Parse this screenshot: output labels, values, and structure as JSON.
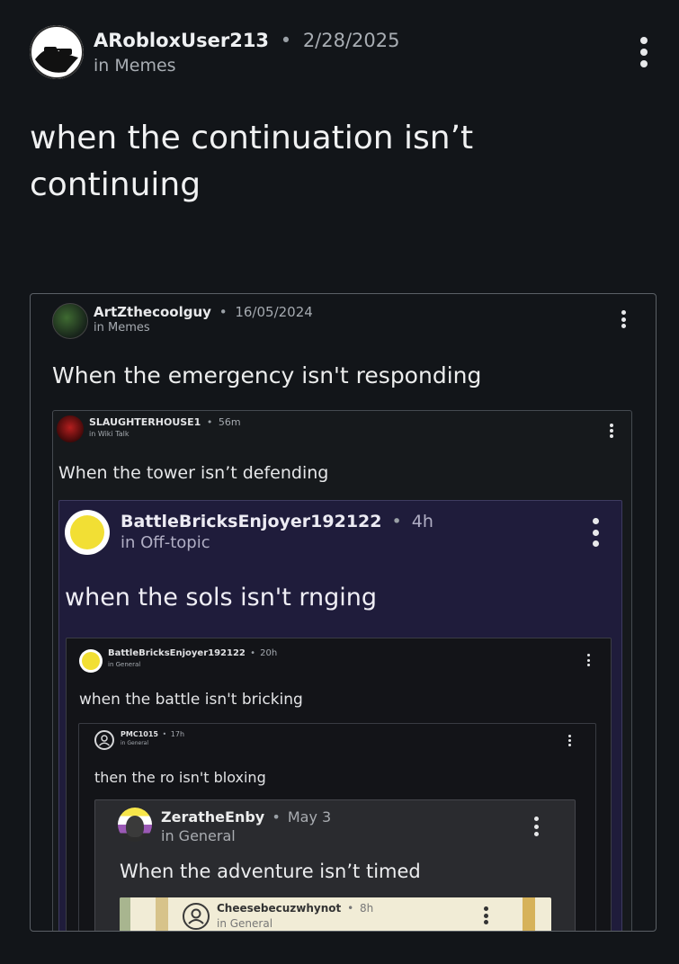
{
  "post": {
    "username": "ARobloxUser213",
    "date": "2/28/2025",
    "category": "in Memes",
    "title": "when the continuation isn’t continuing"
  },
  "embeds": [
    {
      "username": "ArtZthecoolguy",
      "time": "16/05/2024",
      "category": "in Memes",
      "text": "When the emergency isn't responding"
    },
    {
      "username": "SLAUGHTERHOUSE1",
      "time": "56m",
      "category": "in Wiki Talk",
      "text": "When the tower isn’t defending"
    },
    {
      "username": "BattleBricksEnjoyer192122",
      "time": "4h",
      "category": "in Off-topic",
      "text": "when the sols isn't rnging"
    },
    {
      "username": "BattleBricksEnjoyer192122",
      "time": "20h",
      "category": "in General",
      "text": "when the battle isn't bricking"
    },
    {
      "username": "PMC1015",
      "time": "17h",
      "category": "in General",
      "text": "then the ro isn't bloxing"
    },
    {
      "username": "ZeratheEnby",
      "time": "May 3",
      "category": "in General",
      "text": "When the adventure isn’t timed"
    },
    {
      "username": "Cheesebecuzwhynot",
      "time": "8h",
      "category": "in General",
      "text": ""
    }
  ],
  "separator": "•",
  "colors": {
    "background": "#121519",
    "level3_bg": "#1f1c3b",
    "level6_bg": "#f1ecd6",
    "avatar_yellow": "#f2df34"
  },
  "icons": [
    "sunglasses-avatar-icon",
    "kebab-menu-icon",
    "default-user-icon"
  ]
}
